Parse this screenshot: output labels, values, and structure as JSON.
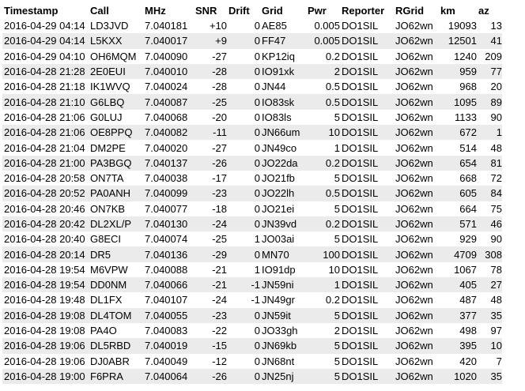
{
  "table": {
    "headers": [
      "Timestamp",
      "Call",
      "MHz",
      "SNR",
      "Drift",
      "Grid",
      "Pwr",
      "Reporter",
      "RGrid",
      "km",
      "az"
    ],
    "rows": [
      [
        "2016-04-29 04:14",
        "LD3JVD",
        "7.040181",
        "+10",
        "0",
        "AE85",
        "0.005",
        "DO1SIL",
        "JO62wn",
        "19093",
        "13"
      ],
      [
        "2016-04-29 04:14",
        "L5KXX",
        "7.040017",
        "+9",
        "0",
        "FF47",
        "0.005",
        "DO1SIL",
        "JO62wn",
        "12501",
        "41"
      ],
      [
        "2016-04-29 04:10",
        "OH6MQM",
        "7.040090",
        "-27",
        "0",
        "KP12iq",
        "0.2",
        "DO1SIL",
        "JO62wn",
        "1240",
        "209"
      ],
      [
        "2016-04-28 21:28",
        "2E0EUI",
        "7.040010",
        "-28",
        "0",
        "IO91xk",
        "2",
        "DO1SIL",
        "JO62wn",
        "959",
        "77"
      ],
      [
        "2016-04-28 21:18",
        "IK1WVQ",
        "7.040024",
        "-28",
        "0",
        "JN44",
        "0.5",
        "DO1SIL",
        "JO62wn",
        "968",
        "20"
      ],
      [
        "2016-04-28 21:10",
        "G6LBQ",
        "7.040087",
        "-25",
        "0",
        "IO83sk",
        "0.5",
        "DO1SIL",
        "JO62wn",
        "1095",
        "89"
      ],
      [
        "2016-04-28 21:06",
        "G0LUJ",
        "7.040068",
        "-20",
        "0",
        "IO83ls",
        "5",
        "DO1SIL",
        "JO62wn",
        "1133",
        "90"
      ],
      [
        "2016-04-28 21:06",
        "OE8PPQ",
        "7.040082",
        "-11",
        "0",
        "JN66um",
        "10",
        "DO1SIL",
        "JO62wn",
        "672",
        "1"
      ],
      [
        "2016-04-28 21:04",
        "DM2PE",
        "7.040020",
        "-27",
        "0",
        "JN49co",
        "1",
        "DO1SIL",
        "JO62wn",
        "514",
        "48"
      ],
      [
        "2016-04-28 21:00",
        "PA3BGQ",
        "7.040137",
        "-26",
        "0",
        "JO22da",
        "0.2",
        "DO1SIL",
        "JO62wn",
        "654",
        "81"
      ],
      [
        "2016-04-28 20:58",
        "ON7TA",
        "7.040038",
        "-17",
        "0",
        "JO21fb",
        "5",
        "DO1SIL",
        "JO62wn",
        "668",
        "72"
      ],
      [
        "2016-04-28 20:52",
        "PA0ANH",
        "7.040099",
        "-23",
        "0",
        "JO22lh",
        "0.5",
        "DO1SIL",
        "JO62wn",
        "605",
        "84"
      ],
      [
        "2016-04-28 20:46",
        "ON7KB",
        "7.040077",
        "-18",
        "0",
        "JO21ei",
        "5",
        "DO1SIL",
        "JO62wn",
        "664",
        "75"
      ],
      [
        "2016-04-28 20:42",
        "DL2XL/P",
        "7.040130",
        "-24",
        "0",
        "JN39vd",
        "0.2",
        "DO1SIL",
        "JO62wn",
        "571",
        "46"
      ],
      [
        "2016-04-28 20:40",
        "G8ECI",
        "7.040074",
        "-25",
        "1",
        "JO03ai",
        "5",
        "DO1SIL",
        "JO62wn",
        "929",
        "90"
      ],
      [
        "2016-04-28 20:14",
        "DR5",
        "7.040136",
        "-29",
        "0",
        "MN70",
        "100",
        "DO1SIL",
        "JO62wn",
        "4709",
        "308"
      ],
      [
        "2016-04-28 19:54",
        "M6VPW",
        "7.040088",
        "-21",
        "1",
        "IO91dp",
        "10",
        "DO1SIL",
        "JO62wn",
        "1067",
        "78"
      ],
      [
        "2016-04-28 19:54",
        "DD0NM",
        "7.040066",
        "-21",
        "-1",
        "JN59ni",
        "1",
        "DO1SIL",
        "JO62wn",
        "405",
        "27"
      ],
      [
        "2016-04-28 19:48",
        "DL1FX",
        "7.040107",
        "-24",
        "-1",
        "JN49gr",
        "0.2",
        "DO1SIL",
        "JO62wn",
        "487",
        "48"
      ],
      [
        "2016-04-28 19:08",
        "DL4TOM",
        "7.040055",
        "-23",
        "0",
        "JN59it",
        "5",
        "DO1SIL",
        "JO62wn",
        "377",
        "35"
      ],
      [
        "2016-04-28 19:08",
        "PA4O",
        "7.040083",
        "-22",
        "0",
        "JO33gh",
        "2",
        "DO1SIL",
        "JO62wn",
        "498",
        "97"
      ],
      [
        "2016-04-28 19:06",
        "DL5RBD",
        "7.040019",
        "-15",
        "0",
        "JN69kb",
        "5",
        "DO1SIL",
        "JO62wn",
        "395",
        "10"
      ],
      [
        "2016-04-28 19:06",
        "DJ0ABR",
        "7.040049",
        "-12",
        "0",
        "JN68nt",
        "5",
        "DO1SIL",
        "JO62wn",
        "420",
        "7"
      ],
      [
        "2016-04-28 19:00",
        "F6PRA",
        "7.040064",
        "-26",
        "0",
        "JN25nj",
        "5",
        "DO1SIL",
        "JO62wn",
        "1020",
        "35"
      ]
    ]
  }
}
